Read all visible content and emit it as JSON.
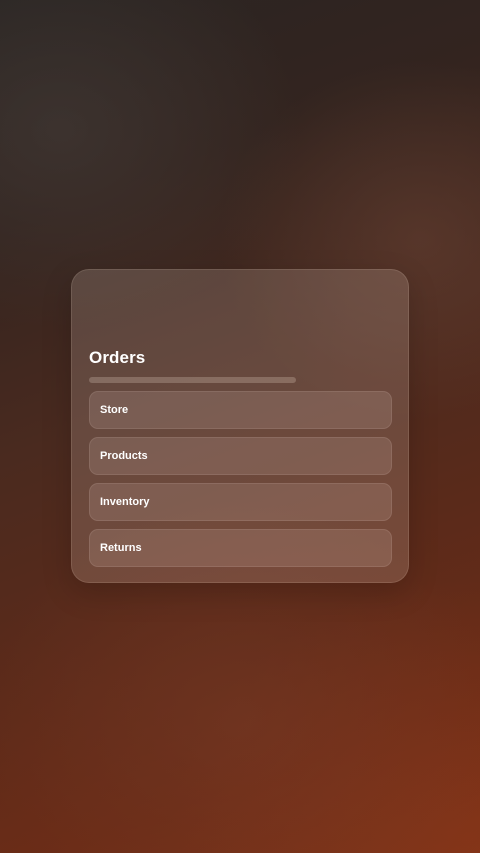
{
  "card": {
    "title": "Orders",
    "menu": [
      {
        "label": "Store"
      },
      {
        "label": "Products"
      },
      {
        "label": "Inventory"
      },
      {
        "label": "Returns"
      }
    ]
  }
}
